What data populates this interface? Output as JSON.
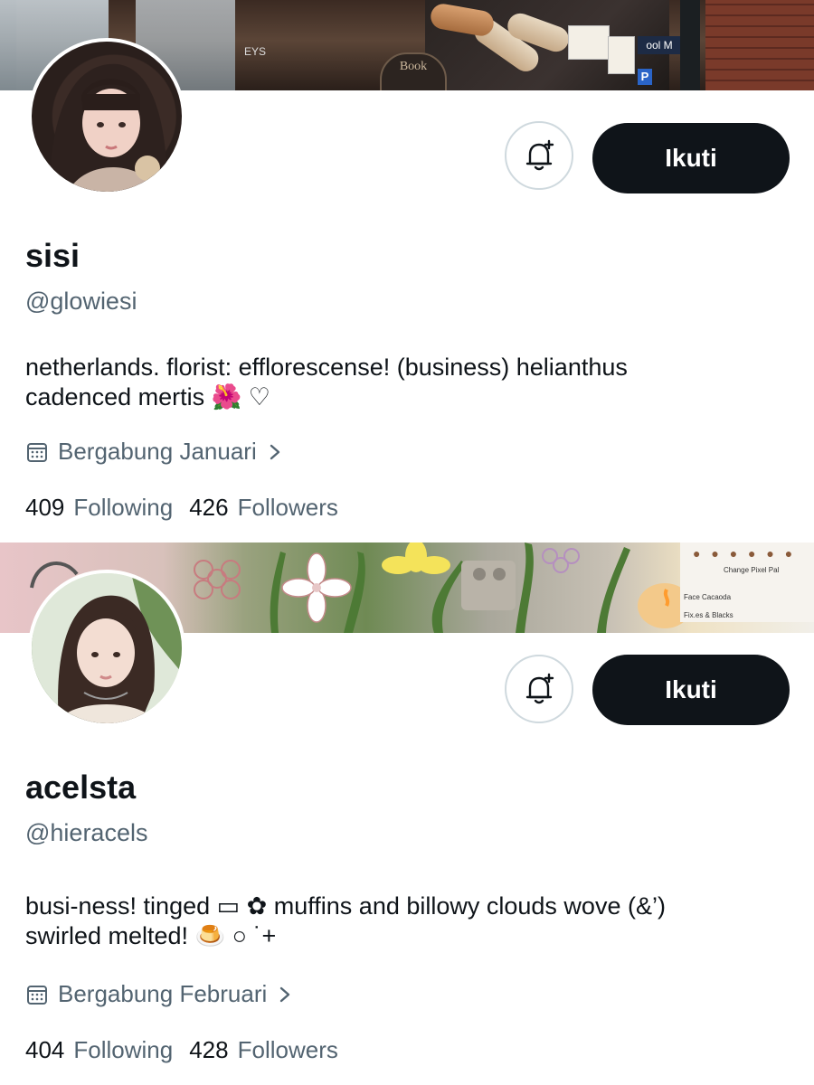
{
  "profiles": [
    {
      "name": "sisi",
      "handle": "@glowiesi",
      "bio_line1": "netherlands. florist: efflorescense! (business) helianthus",
      "bio_line2": "cadenced mertis 🌺 ♡",
      "joined": "Bergabung Januari",
      "following_count": "409",
      "following_label": "Following",
      "followers_count": "426",
      "followers_label": "Followers",
      "follow_button": "Ikuti",
      "banner_text": {
        "book": "Book",
        "sign": "ool M",
        "p": "P",
        "window": "EYS"
      }
    },
    {
      "name": "acelsta",
      "handle": "@hieracels",
      "bio_line1": "busi-ness! tinged ▭ ✿ muffins and billowy clouds wove (&’)",
      "bio_line2": "swirled melted! 🍮 ○ ˙+",
      "joined": "Bergabung Februari",
      "following_count": "404",
      "following_label": "Following",
      "followers_count": "428",
      "followers_label": "Followers",
      "follow_button": "Ikuti",
      "banner_text": {
        "note1": "Change Pixel Pal",
        "note2": "Face Cacaoda",
        "note3": "Fix.es & Blacks"
      }
    }
  ],
  "icons": {
    "bell": "bell-plus-icon",
    "calendar": "calendar-icon",
    "chevron": "chevron-right-icon"
  },
  "colors": {
    "text": "#0f1419",
    "muted": "#536471",
    "button": "#0f1419",
    "border": "#cfd9de"
  }
}
